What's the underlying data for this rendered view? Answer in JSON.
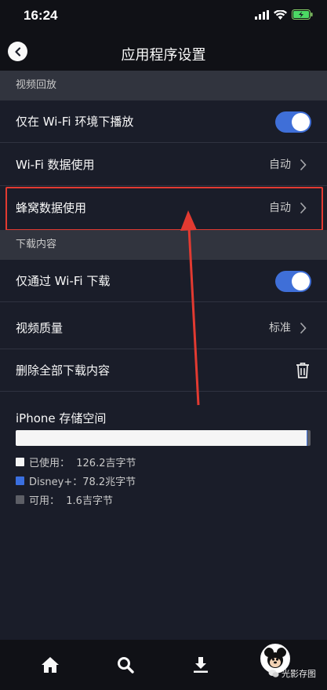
{
  "status_bar": {
    "time": "16:24"
  },
  "header": {
    "title": "应用程序设置"
  },
  "sections": {
    "playback": {
      "title": "视频回放",
      "wifi_only_label": "仅在 Wi-Fi 环境下播放",
      "wifi_data_label": "Wi-Fi 数据使用",
      "wifi_data_value": "自动",
      "cellular_label": "蜂窝数据使用",
      "cellular_value": "自动"
    },
    "downloads": {
      "title": "下载内容",
      "wifi_download_label": "仅通过 Wi-Fi 下载",
      "quality_label": "视频质量",
      "quality_value": "标准",
      "delete_label": "删除全部下载内容"
    }
  },
  "storage": {
    "title": "iPhone 存储空间",
    "used_label": "已使用：  126.2吉字节",
    "disney_label": "Disney+：78.2兆字节",
    "free_label": "可用：  1.6吉字节",
    "used_fraction": 0.986,
    "disney_fraction": 0.002
  },
  "toggles": {
    "wifi_only_playback": true,
    "wifi_only_download": true
  },
  "colors": {
    "accent": "#3f6fd8",
    "highlight": "#e23a31",
    "used_swatch": "#f5f5f5",
    "disney_swatch": "#3a6fe0",
    "free_swatch": "#5d5f66"
  },
  "tabs": [
    "home-icon",
    "search-icon",
    "downloads-icon",
    "profile-avatar"
  ],
  "watermark": {
    "text": "光影存图"
  }
}
